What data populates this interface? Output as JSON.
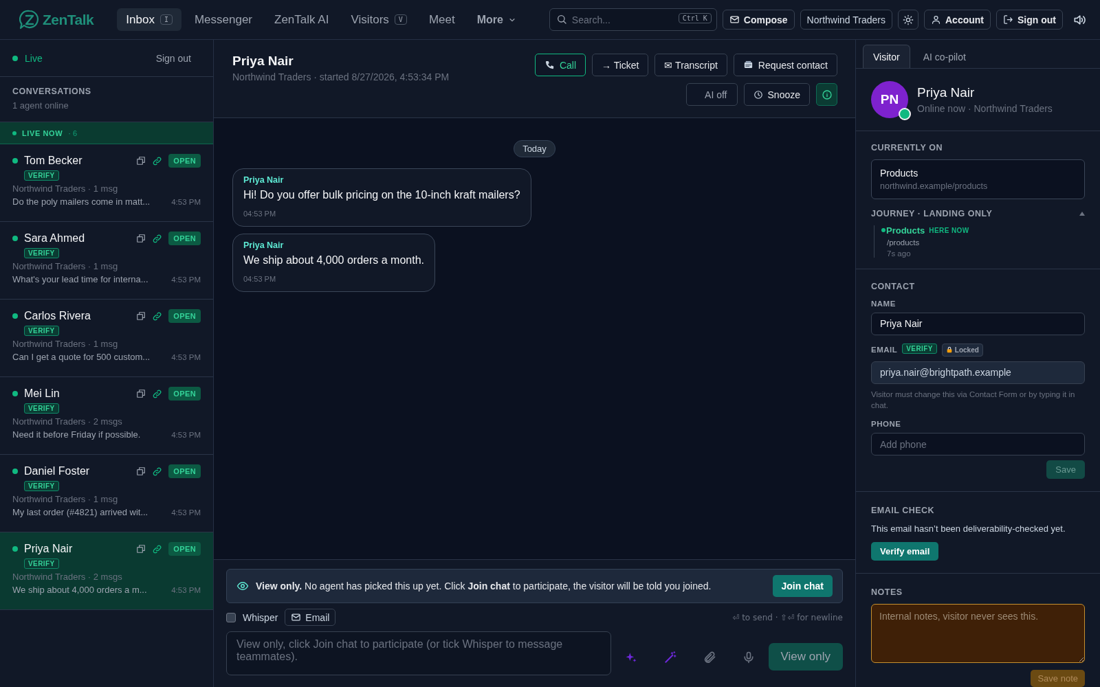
{
  "topbar": {
    "logo": "ZenTalk",
    "nav": [
      {
        "label": "Inbox",
        "shortcut": "I",
        "selected": true
      },
      {
        "label": "Messenger",
        "selected": false
      },
      {
        "label": "ZenTalk AI",
        "selected": false
      },
      {
        "label": "Visitors",
        "shortcut": "V",
        "selected": false
      },
      {
        "label": "Meet",
        "selected": false
      },
      {
        "label": "More",
        "kind": "menu",
        "selected": false
      }
    ],
    "search": {
      "placeholder": "Search...",
      "shortcut": "Ctrl K"
    },
    "actions": [
      {
        "kind": "compose",
        "label": "Compose"
      },
      {
        "kind": "workspace",
        "label": "Northwind Traders"
      },
      {
        "kind": "theme"
      },
      {
        "kind": "account",
        "label": "Account"
      },
      {
        "kind": "signout",
        "label": "Sign out"
      },
      {
        "kind": "sound"
      }
    ]
  },
  "sidebar": {
    "status": "Live",
    "sign_out": "Sign out",
    "heading": "CONVERSATIONS",
    "subheading": "1 agent online",
    "live_now": {
      "label": "LIVE NOW",
      "count": "· 6"
    },
    "conversations": [
      {
        "name": "Tom Becker",
        "badge": "VERIFY",
        "status": "OPEN",
        "meta": "Northwind Traders · 1 msg",
        "preview": "Do the poly mailers come in matt...",
        "time": "4:53 PM",
        "selected": false
      },
      {
        "name": "Sara Ahmed",
        "badge": "VERIFY",
        "status": "OPEN",
        "meta": "Northwind Traders · 1 msg",
        "preview": "What's your lead time for interna...",
        "time": "4:53 PM",
        "selected": false
      },
      {
        "name": "Carlos Rivera",
        "badge": "VERIFY",
        "status": "OPEN",
        "meta": "Northwind Traders · 1 msg",
        "preview": "Can I get a quote for 500 custom...",
        "time": "4:53 PM",
        "selected": false
      },
      {
        "name": "Mei Lin",
        "badge": "VERIFY",
        "status": "OPEN",
        "meta": "Northwind Traders · 2 msgs",
        "preview": "Need it before Friday if possible.",
        "time": "4:53 PM",
        "selected": false
      },
      {
        "name": "Daniel Foster",
        "badge": "VERIFY",
        "status": "OPEN",
        "meta": "Northwind Traders · 1 msg",
        "preview": "My last order (#4821) arrived wit...",
        "time": "4:53 PM",
        "selected": false
      },
      {
        "name": "Priya Nair",
        "badge": "VERIFY",
        "status": "OPEN",
        "meta": "Northwind Traders · 2 msgs",
        "preview": "We ship about 4,000 orders a m...",
        "time": "4:53 PM",
        "selected": true
      }
    ]
  },
  "chat": {
    "name": "Priya Nair",
    "subtitle": "Northwind Traders · started 8/27/2026, 4:53:34 PM",
    "actions": [
      {
        "kind": "call",
        "label": "Call"
      },
      {
        "kind": "plain",
        "label": "→ Ticket"
      },
      {
        "kind": "plain",
        "label": "✉ Transcript"
      },
      {
        "kind": "contact",
        "label": "Request contact"
      }
    ],
    "actions2": [
      {
        "kind": "plain",
        "label": "AI off"
      },
      {
        "kind": "snooze",
        "label": "Snooze"
      },
      {
        "kind": "info"
      }
    ],
    "date": "Today",
    "messages": [
      {
        "sender": "Priya Nair",
        "text": "Hi! Do you offer bulk pricing on the 10-inch kraft mailers?",
        "time": "04:53 PM"
      },
      {
        "sender": "Priya Nair",
        "text": "We ship about 4,000 orders a month.",
        "time": "04:53 PM"
      }
    ],
    "banner": {
      "text": "**View only.** No agent has picked this up yet. Click **Join chat** to participate, the visitor will be told you joined.",
      "button": "Join chat"
    },
    "composer": {
      "whisper": {
        "label": "Whisper",
        "checked": false
      },
      "email": "Email",
      "hint": "⏎ to send · ⇧⏎ for newline",
      "placeholder": "View only, click Join chat to participate (or tick Whisper to message teammates).",
      "send": {
        "label": "View only",
        "disabled": true
      }
    }
  },
  "panel": {
    "tabs": [
      {
        "label": "Visitor",
        "selected": true
      },
      {
        "label": "AI co-pilot",
        "selected": false
      }
    ],
    "visitor": {
      "initials": "PN",
      "name": "Priya Nair",
      "status": "Online now · Northwind Traders",
      "online": true
    },
    "currently_on": {
      "heading": "CURRENTLY ON",
      "title": "Products",
      "url": "northwind.example/products"
    },
    "journey": {
      "heading": "JOURNEY · LANDING ONLY",
      "expanded": true,
      "steps": [
        {
          "title": "Products",
          "badge": "HERE NOW",
          "path": "/products",
          "time": "7s ago"
        }
      ]
    },
    "contact": {
      "heading": "CONTACT",
      "name": {
        "label": "NAME",
        "value": "Priya Nair"
      },
      "email": {
        "label": "EMAIL",
        "badge": "VERIFY",
        "lock": "Locked",
        "value": "priya.nair@brightpath.example",
        "note": "Visitor must change this via Contact Form or by typing it in chat."
      },
      "phone": {
        "label": "PHONE",
        "placeholder": "Add phone"
      },
      "save": "Save"
    },
    "email_check": {
      "heading": "EMAIL CHECK",
      "text": "This email hasn’t been deliverability-checked yet.",
      "button": "Verify email"
    },
    "notes": {
      "heading": "NOTES",
      "placeholder": "Internal notes, visitor never sees this.",
      "button": "Save note"
    }
  }
}
